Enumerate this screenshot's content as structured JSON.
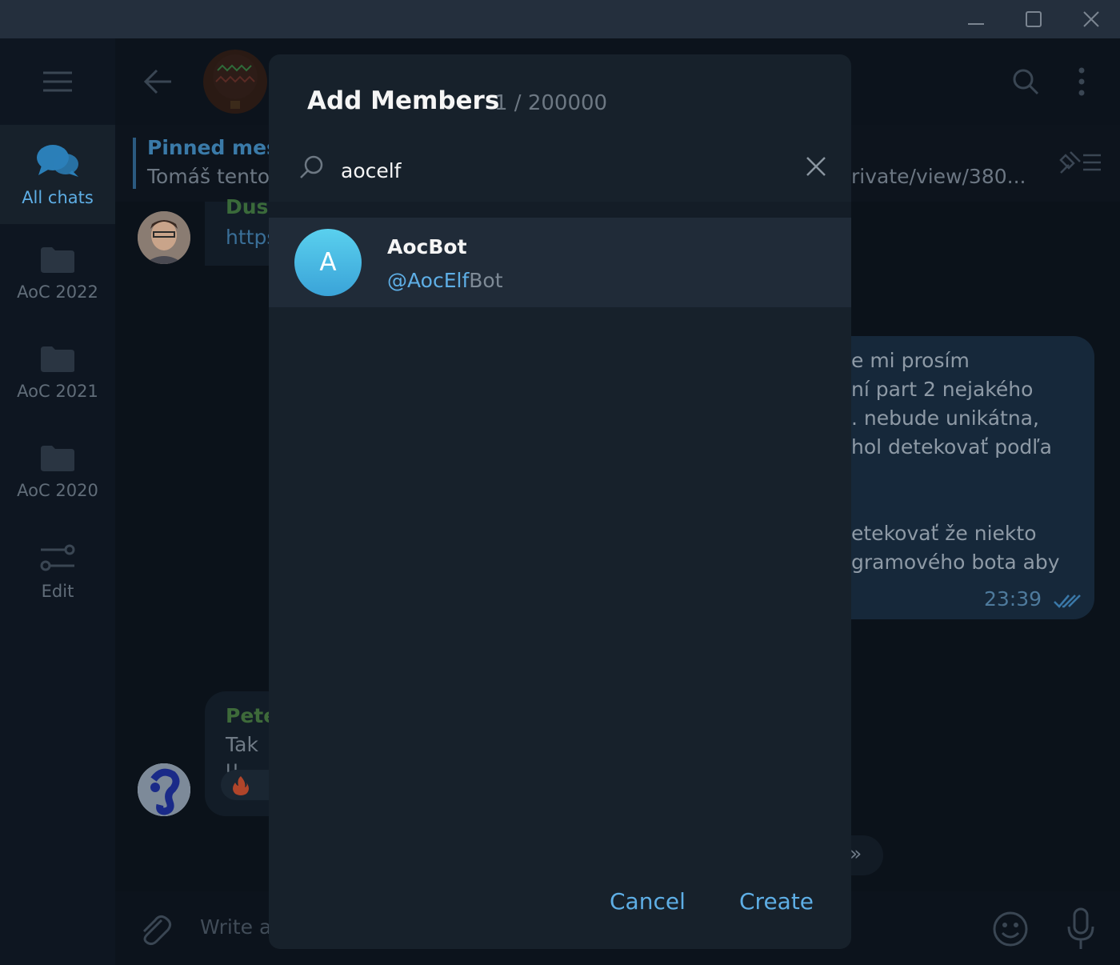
{
  "window": {
    "controls": [
      "minimize",
      "maximize",
      "close"
    ]
  },
  "sidebar": {
    "menu_icon": "hamburger-icon",
    "folders": [
      {
        "label": "All chats",
        "icon": "chats-icon",
        "active": true
      },
      {
        "label": "AoC 2022",
        "icon": "folder-icon",
        "active": false
      },
      {
        "label": "AoC 2021",
        "icon": "folder-icon",
        "active": false
      },
      {
        "label": "AoC 2020",
        "icon": "folder-icon",
        "active": false
      },
      {
        "label": "Edit",
        "icon": "edit-sliders-icon",
        "active": false
      }
    ]
  },
  "chat": {
    "pinned_title": "Pinned mess",
    "pinned_text": "Tomáš tento",
    "pinned_link_tail": "rivate/view/380...",
    "msg1_sender": "Dusa",
    "msg1_link": "https",
    "bubble_lines": [
      "e mi prosím",
      "ní part 2 nejakého",
      ". nebude unikátna,",
      "hol detekovať podľa",
      "etekovať že niekto",
      "gramového bota aby"
    ],
    "bubble_time": "23:39",
    "msg2_sender": "Pete",
    "msg2_text": "Tak u",
    "composer_placeholder": "Write a",
    "scroll_down_glyph": "»"
  },
  "modal": {
    "title": "Add Members",
    "count": "1 / 200000",
    "search_value": "aocelf",
    "result": {
      "initial": "A",
      "name": "AocBot",
      "handle_match": "@AocElf",
      "handle_rest": "Bot"
    },
    "cancel_label": "Cancel",
    "create_label": "Create"
  },
  "colors": {
    "accent": "#5eaee5",
    "modal_bg": "#17212b",
    "selected_row": "#202b38"
  }
}
